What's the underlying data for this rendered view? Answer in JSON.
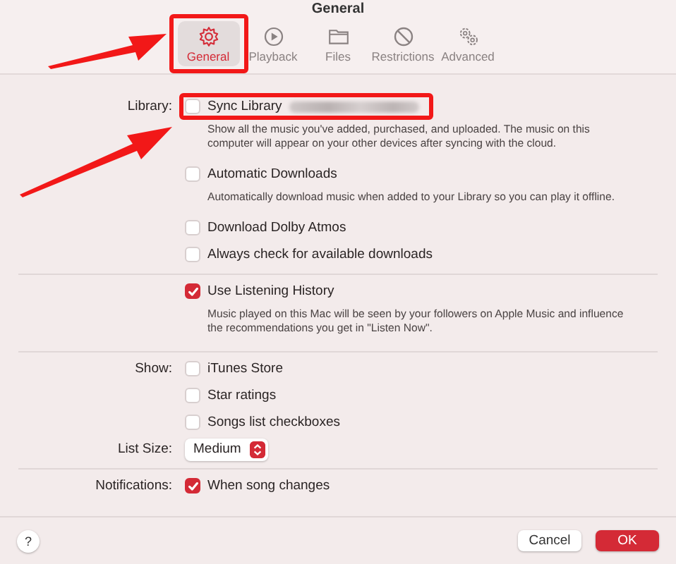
{
  "window": {
    "title": "General"
  },
  "tabs": [
    {
      "label": "General",
      "kind": "gear",
      "selected": true,
      "highlighted": true
    },
    {
      "label": "Playback",
      "kind": "play",
      "selected": false,
      "highlighted": false
    },
    {
      "label": "Files",
      "kind": "folder",
      "selected": false,
      "highlighted": false
    },
    {
      "label": "Restrictions",
      "kind": "prohibit",
      "selected": false,
      "highlighted": false
    },
    {
      "label": "Advanced",
      "kind": "gears",
      "selected": false,
      "highlighted": false
    }
  ],
  "sections": [
    {
      "rows": [
        {
          "label": "Library:",
          "kind": "checkbox",
          "text": "Sync Library",
          "checked": false,
          "redacted": true,
          "highlighted": true,
          "description": "Show all the music you've added, purchased, and uploaded. The music on this computer will appear on your other devices after syncing with the cloud."
        },
        {
          "kind": "checkbox",
          "text": "Automatic Downloads",
          "checked": false,
          "description": "Automatically download music when added to your Library so you can play it offline."
        },
        {
          "kind": "checkbox",
          "text": "Download Dolby Atmos",
          "checked": false
        },
        {
          "kind": "checkbox",
          "text": "Always check for available downloads",
          "checked": false
        }
      ]
    },
    {
      "rows": [
        {
          "kind": "checkbox",
          "text": "Use Listening History",
          "checked": true,
          "description": "Music played on this Mac will be seen by your followers on Apple Music and influence the recommendations you get in \"Listen Now\"."
        }
      ]
    },
    {
      "rows": [
        {
          "label": "Show:",
          "kind": "checkbox",
          "text": "iTunes Store",
          "checked": false
        },
        {
          "kind": "checkbox",
          "text": "Star ratings",
          "checked": false
        },
        {
          "kind": "checkbox",
          "text": "Songs list checkboxes",
          "checked": false
        },
        {
          "label": "List Size:",
          "kind": "popup",
          "value": "Medium"
        }
      ]
    },
    {
      "rows": [
        {
          "label": "Notifications:",
          "kind": "checkbox",
          "text": "When song changes",
          "checked": true
        }
      ]
    }
  ],
  "footer": {
    "help": "?",
    "buttons": [
      {
        "label": "Cancel",
        "kind": "default"
      },
      {
        "label": "OK",
        "kind": "primary"
      }
    ]
  }
}
